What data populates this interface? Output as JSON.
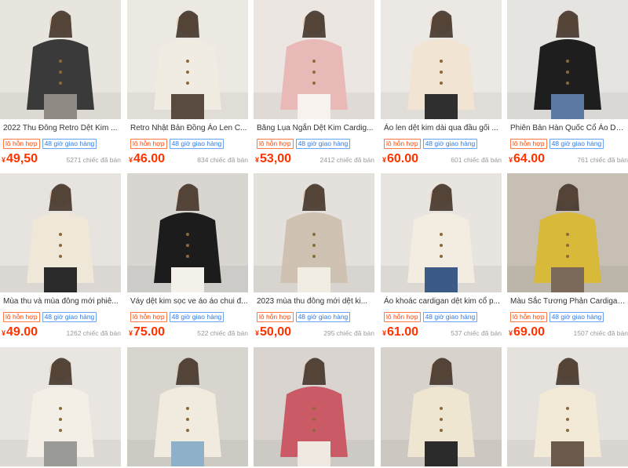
{
  "colors": {
    "price": "#ff3300",
    "badge_red": "#ff4400",
    "badge_blue": "#2f7ae5"
  },
  "products": [
    {
      "title": "2022 Thu Đông Retro Dệt Kim ...",
      "badge1": "lô hỗn hợp",
      "badge2": "48 giờ giao hàng",
      "currency": "¥",
      "price": "49,50",
      "sold": "5271 chiếc đã bán",
      "img": [
        "#e8e4de",
        "#3a3a3a",
        "#8f8a84"
      ]
    },
    {
      "title": "Retro Nhật Bản Đồng Áo Len C...",
      "badge1": "lô hỗn hợp",
      "badge2": "48 giờ giao hàng",
      "currency": "¥",
      "price": "46.00",
      "sold": "834 chiếc đã bán",
      "img": [
        "#ece9e3",
        "#f1ece1",
        "#5a4b40"
      ]
    },
    {
      "title": "Băng Lụa Ngắn Dệt Kim Cardig...",
      "badge1": "lô hỗn hợp",
      "badge2": "48 giờ giao hàng",
      "currency": "¥",
      "price": "53,00",
      "sold": "2412 chiếc đã bán",
      "img": [
        "#ece6e2",
        "#e9b9b8",
        "#f7f2ee"
      ]
    },
    {
      "title": "Áo len dệt kim dài qua đầu gối ...",
      "badge1": "lô hỗn hợp",
      "badge2": "48 giờ giao hàng",
      "currency": "¥",
      "price": "60.00",
      "sold": "601 chiếc đã bán",
      "img": [
        "#ece9e5",
        "#f2e4d2",
        "#2f2f2f"
      ]
    },
    {
      "title": "Phiên Bản Hàn Quốc Cổ Áo Dây...",
      "badge1": "lô hỗn hợp",
      "badge2": "48 giờ giao hàng",
      "currency": "¥",
      "price": "64.00",
      "sold": "761 chiếc đã bán",
      "img": [
        "#e6e4e0",
        "#1e1e1e",
        "#5b79a3"
      ]
    },
    {
      "title": "Mùa thu và mùa đông mới phiê...",
      "badge1": "lô hỗn hợp",
      "badge2": "48 giờ giao hàng",
      "currency": "¥",
      "price": "49.00",
      "sold": "1262 chiếc đã bán",
      "img": [
        "#e7e3de",
        "#efe7d8",
        "#2a2a2a"
      ]
    },
    {
      "title": "Váy dệt kim sọc ve áo áo chui đ...",
      "badge1": "lô hỗn hợp",
      "badge2": "48 giờ giao hàng",
      "currency": "¥",
      "price": "75.00",
      "sold": "522 chiếc đã bán",
      "img": [
        "#d9d6d2",
        "#1c1c1c",
        "#f4f1ea"
      ]
    },
    {
      "title": "2023 mùa thu đông mới dệt ki...",
      "badge1": "lô hỗn hợp",
      "badge2": "48 giờ giao hàng",
      "currency": "¥",
      "price": "50,00",
      "sold": "295 chiếc đã bán",
      "img": [
        "#e4e0dc",
        "#cfc2b3",
        "#f2ede3"
      ]
    },
    {
      "title": "Áo khoác cardigan dệt kim cổ p...",
      "badge1": "lô hỗn hợp",
      "badge2": "48 giờ giao hàng",
      "currency": "¥",
      "price": "61.00",
      "sold": "537 chiếc đã bán",
      "img": [
        "#e8e4df",
        "#f3ece0",
        "#3c5a86"
      ]
    },
    {
      "title": "Màu Sắc Tương Phản Cardigan ...",
      "badge1": "lô hỗn hợp",
      "badge2": "48 giờ giao hàng",
      "currency": "¥",
      "price": "69.00",
      "sold": "1507 chiếc đã bán",
      "img": [
        "#c7bfb4",
        "#d8b93a",
        "#7b6a5a"
      ]
    },
    {
      "title": "",
      "badge1": "",
      "badge2": "",
      "currency": "",
      "price": "",
      "sold": "",
      "img": [
        "#e9e6e2",
        "#f3efe6",
        "#9a9a96"
      ]
    },
    {
      "title": "",
      "badge1": "",
      "badge2": "",
      "currency": "",
      "price": "",
      "sold": "",
      "img": [
        "#d8d4ce",
        "#f1ebdf",
        "#8fb0c9"
      ]
    },
    {
      "title": "",
      "badge1": "",
      "badge2": "",
      "currency": "",
      "price": "",
      "sold": "",
      "img": [
        "#d9d4cf",
        "#c95a66",
        "#efe9e2"
      ]
    },
    {
      "title": "",
      "badge1": "",
      "badge2": "",
      "currency": "",
      "price": "",
      "sold": "",
      "img": [
        "#d7d2cc",
        "#efe6d2",
        "#2b2b2b"
      ]
    },
    {
      "title": "",
      "badge1": "",
      "badge2": "",
      "currency": "",
      "price": "",
      "sold": "",
      "img": [
        "#e5e2de",
        "#f2ead6",
        "#6b5a4c"
      ]
    }
  ]
}
